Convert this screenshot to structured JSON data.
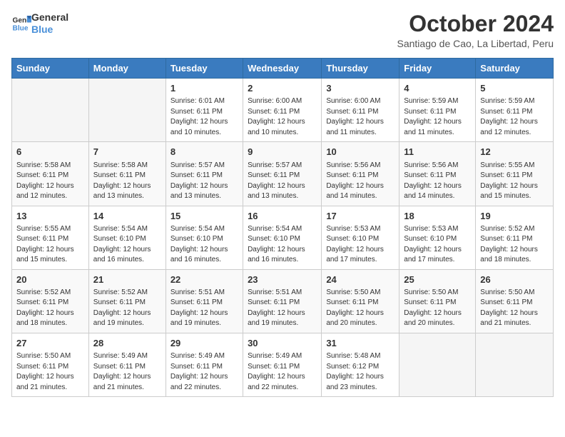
{
  "logo": {
    "line1": "General",
    "line2": "Blue"
  },
  "title": "October 2024",
  "subtitle": "Santiago de Cao, La Libertad, Peru",
  "weekdays": [
    "Sunday",
    "Monday",
    "Tuesday",
    "Wednesday",
    "Thursday",
    "Friday",
    "Saturday"
  ],
  "weeks": [
    [
      {
        "day": "",
        "info": ""
      },
      {
        "day": "",
        "info": ""
      },
      {
        "day": "1",
        "info": "Sunrise: 6:01 AM\nSunset: 6:11 PM\nDaylight: 12 hours\nand 10 minutes."
      },
      {
        "day": "2",
        "info": "Sunrise: 6:00 AM\nSunset: 6:11 PM\nDaylight: 12 hours\nand 10 minutes."
      },
      {
        "day": "3",
        "info": "Sunrise: 6:00 AM\nSunset: 6:11 PM\nDaylight: 12 hours\nand 11 minutes."
      },
      {
        "day": "4",
        "info": "Sunrise: 5:59 AM\nSunset: 6:11 PM\nDaylight: 12 hours\nand 11 minutes."
      },
      {
        "day": "5",
        "info": "Sunrise: 5:59 AM\nSunset: 6:11 PM\nDaylight: 12 hours\nand 12 minutes."
      }
    ],
    [
      {
        "day": "6",
        "info": "Sunrise: 5:58 AM\nSunset: 6:11 PM\nDaylight: 12 hours\nand 12 minutes."
      },
      {
        "day": "7",
        "info": "Sunrise: 5:58 AM\nSunset: 6:11 PM\nDaylight: 12 hours\nand 13 minutes."
      },
      {
        "day": "8",
        "info": "Sunrise: 5:57 AM\nSunset: 6:11 PM\nDaylight: 12 hours\nand 13 minutes."
      },
      {
        "day": "9",
        "info": "Sunrise: 5:57 AM\nSunset: 6:11 PM\nDaylight: 12 hours\nand 13 minutes."
      },
      {
        "day": "10",
        "info": "Sunrise: 5:56 AM\nSunset: 6:11 PM\nDaylight: 12 hours\nand 14 minutes."
      },
      {
        "day": "11",
        "info": "Sunrise: 5:56 AM\nSunset: 6:11 PM\nDaylight: 12 hours\nand 14 minutes."
      },
      {
        "day": "12",
        "info": "Sunrise: 5:55 AM\nSunset: 6:11 PM\nDaylight: 12 hours\nand 15 minutes."
      }
    ],
    [
      {
        "day": "13",
        "info": "Sunrise: 5:55 AM\nSunset: 6:11 PM\nDaylight: 12 hours\nand 15 minutes."
      },
      {
        "day": "14",
        "info": "Sunrise: 5:54 AM\nSunset: 6:10 PM\nDaylight: 12 hours\nand 16 minutes."
      },
      {
        "day": "15",
        "info": "Sunrise: 5:54 AM\nSunset: 6:10 PM\nDaylight: 12 hours\nand 16 minutes."
      },
      {
        "day": "16",
        "info": "Sunrise: 5:54 AM\nSunset: 6:10 PM\nDaylight: 12 hours\nand 16 minutes."
      },
      {
        "day": "17",
        "info": "Sunrise: 5:53 AM\nSunset: 6:10 PM\nDaylight: 12 hours\nand 17 minutes."
      },
      {
        "day": "18",
        "info": "Sunrise: 5:53 AM\nSunset: 6:10 PM\nDaylight: 12 hours\nand 17 minutes."
      },
      {
        "day": "19",
        "info": "Sunrise: 5:52 AM\nSunset: 6:11 PM\nDaylight: 12 hours\nand 18 minutes."
      }
    ],
    [
      {
        "day": "20",
        "info": "Sunrise: 5:52 AM\nSunset: 6:11 PM\nDaylight: 12 hours\nand 18 minutes."
      },
      {
        "day": "21",
        "info": "Sunrise: 5:52 AM\nSunset: 6:11 PM\nDaylight: 12 hours\nand 19 minutes."
      },
      {
        "day": "22",
        "info": "Sunrise: 5:51 AM\nSunset: 6:11 PM\nDaylight: 12 hours\nand 19 minutes."
      },
      {
        "day": "23",
        "info": "Sunrise: 5:51 AM\nSunset: 6:11 PM\nDaylight: 12 hours\nand 19 minutes."
      },
      {
        "day": "24",
        "info": "Sunrise: 5:50 AM\nSunset: 6:11 PM\nDaylight: 12 hours\nand 20 minutes."
      },
      {
        "day": "25",
        "info": "Sunrise: 5:50 AM\nSunset: 6:11 PM\nDaylight: 12 hours\nand 20 minutes."
      },
      {
        "day": "26",
        "info": "Sunrise: 5:50 AM\nSunset: 6:11 PM\nDaylight: 12 hours\nand 21 minutes."
      }
    ],
    [
      {
        "day": "27",
        "info": "Sunrise: 5:50 AM\nSunset: 6:11 PM\nDaylight: 12 hours\nand 21 minutes."
      },
      {
        "day": "28",
        "info": "Sunrise: 5:49 AM\nSunset: 6:11 PM\nDaylight: 12 hours\nand 21 minutes."
      },
      {
        "day": "29",
        "info": "Sunrise: 5:49 AM\nSunset: 6:11 PM\nDaylight: 12 hours\nand 22 minutes."
      },
      {
        "day": "30",
        "info": "Sunrise: 5:49 AM\nSunset: 6:11 PM\nDaylight: 12 hours\nand 22 minutes."
      },
      {
        "day": "31",
        "info": "Sunrise: 5:48 AM\nSunset: 6:12 PM\nDaylight: 12 hours\nand 23 minutes."
      },
      {
        "day": "",
        "info": ""
      },
      {
        "day": "",
        "info": ""
      }
    ]
  ]
}
